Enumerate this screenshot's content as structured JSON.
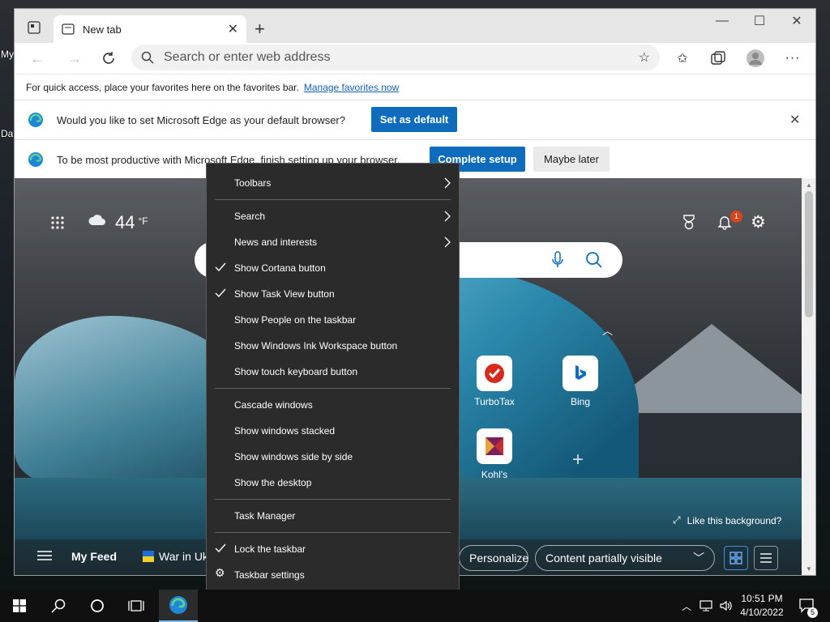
{
  "desktop": {
    "label_1": "My",
    "label_2": "Da"
  },
  "browser": {
    "tab_title": "New tab",
    "address_placeholder": "Search or enter web address",
    "favbar_text": "For quick access, place your favorites here on the favorites bar.",
    "favbar_link": "Manage favorites now",
    "infobar_default": {
      "message": "Would you like to set Microsoft Edge as your default browser?",
      "button": "Set as default"
    },
    "infobar_setup": {
      "message": "To be most productive with Microsoft Edge, finish setting up your browser.",
      "primary": "Complete setup",
      "secondary": "Maybe later"
    }
  },
  "ntp": {
    "temperature": "44",
    "temp_unit": "°F",
    "notification_count": "1",
    "tiles": [
      {
        "label": "TurboTax"
      },
      {
        "label": "Bing"
      },
      {
        "label": "Kohl's"
      }
    ],
    "like_background": "Like this background?",
    "feed": {
      "my_feed": "My Feed",
      "war_tab": "War in Uk",
      "personalize": "Personalize",
      "content_select": "Content partially visible"
    }
  },
  "context_menu": {
    "items": [
      {
        "label": "Toolbars"
      },
      {
        "label": "Search"
      },
      {
        "label": "News and interests"
      },
      {
        "label": "Show Cortana button"
      },
      {
        "label": "Show Task View button"
      },
      {
        "label": "Show People on the taskbar"
      },
      {
        "label": "Show Windows Ink Workspace button"
      },
      {
        "label": "Show touch keyboard button"
      },
      {
        "label": "Cascade windows"
      },
      {
        "label": "Show windows stacked"
      },
      {
        "label": "Show windows side by side"
      },
      {
        "label": "Show the desktop"
      },
      {
        "label": "Task Manager"
      },
      {
        "label": "Lock the taskbar"
      },
      {
        "label": "Taskbar settings"
      }
    ]
  },
  "taskbar": {
    "time": "10:51 PM",
    "date": "4/10/2022",
    "notif_count": "5"
  }
}
